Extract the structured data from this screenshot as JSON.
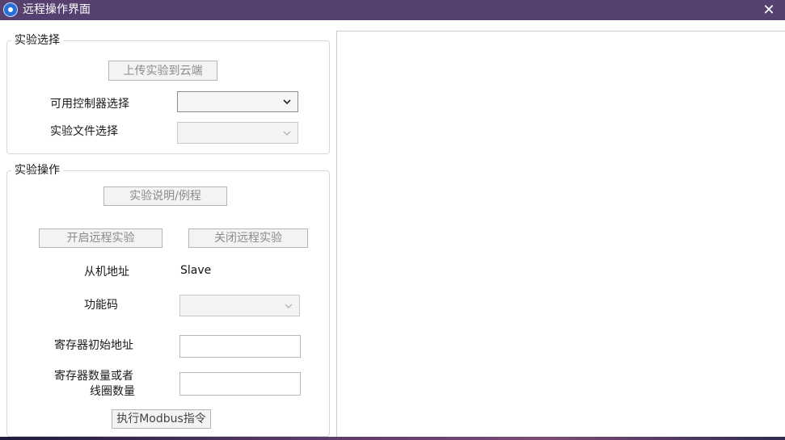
{
  "window": {
    "title": "远程操作界面",
    "icon": "app-logo-icon",
    "close_glyph": "✕"
  },
  "experiment_selection": {
    "legend": "实验选择",
    "upload_button": "上传实验到云端",
    "controller_label": "可用控制器选择",
    "controller_value": "",
    "file_label": "实验文件选择",
    "file_value": ""
  },
  "experiment_operation": {
    "legend": "实验操作",
    "description_button": "实验说明/例程",
    "start_button": "开启远程实验",
    "stop_button": "关闭远程实验",
    "slave_label": "从机地址",
    "slave_value": "Slave",
    "function_code_label": "功能码",
    "function_code_value": "",
    "register_start_label": "寄存器初始地址",
    "register_start_value": "",
    "register_count_label_line1": "寄存器数量或者",
    "register_count_label_line2": "线圈数量",
    "register_count_value": "",
    "execute_button": "执行Modbus指令"
  },
  "colors": {
    "titlebar": "#55406f",
    "border": "#d8d8d8",
    "disabled_text": "#8a8a8a"
  }
}
